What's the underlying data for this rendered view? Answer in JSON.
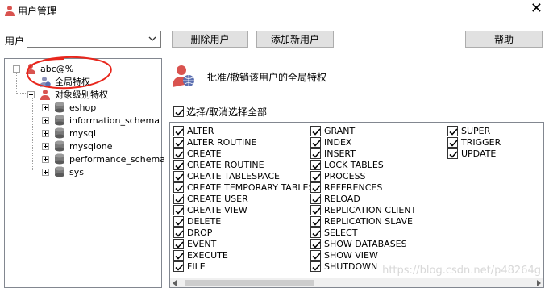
{
  "window": {
    "title": "用户管理",
    "close_glyph": "✕"
  },
  "top": {
    "user_label": "用户",
    "user_value": "",
    "delete_user": "删除用户",
    "add_user": "添加新用户",
    "help": "帮助"
  },
  "tree": {
    "root": "abc@%",
    "global": "全局特权",
    "object": "对象级别特权",
    "databases": [
      "eshop",
      "information_schema",
      "mysql",
      "mysqlone",
      "performance_schema",
      "sys"
    ]
  },
  "content": {
    "header": "批准/撤销该用户的全局特权",
    "select_all": "选择/取消选择全部"
  },
  "privileges": {
    "col1": [
      "ALTER",
      "ALTER ROUTINE",
      "CREATE",
      "CREATE ROUTINE",
      "CREATE TABLESPACE",
      "CREATE TEMPORARY TABLES",
      "CREATE USER",
      "CREATE VIEW",
      "DELETE",
      "DROP",
      "EVENT",
      "EXECUTE",
      "FILE"
    ],
    "col2": [
      "GRANT",
      "INDEX",
      "INSERT",
      "LOCK TABLES",
      "PROCESS",
      "REFERENCES",
      "RELOAD",
      "REPLICATION CLIENT",
      "REPLICATION SLAVE",
      "SELECT",
      "SHOW DATABASES",
      "SHOW VIEW",
      "SHUTDOWN"
    ],
    "col3": [
      "SUPER",
      "TRIGGER",
      "UPDATE"
    ]
  },
  "watermark": "https://blog.csdn.net/p48264g",
  "colors": {
    "annotation": "#e8261c",
    "user_icon": "#d9534f"
  },
  "icons": {
    "app": "user-icon",
    "user": "user-icon",
    "privilege": "user-globe-icon",
    "database": "database-icon",
    "check": "check-icon"
  }
}
